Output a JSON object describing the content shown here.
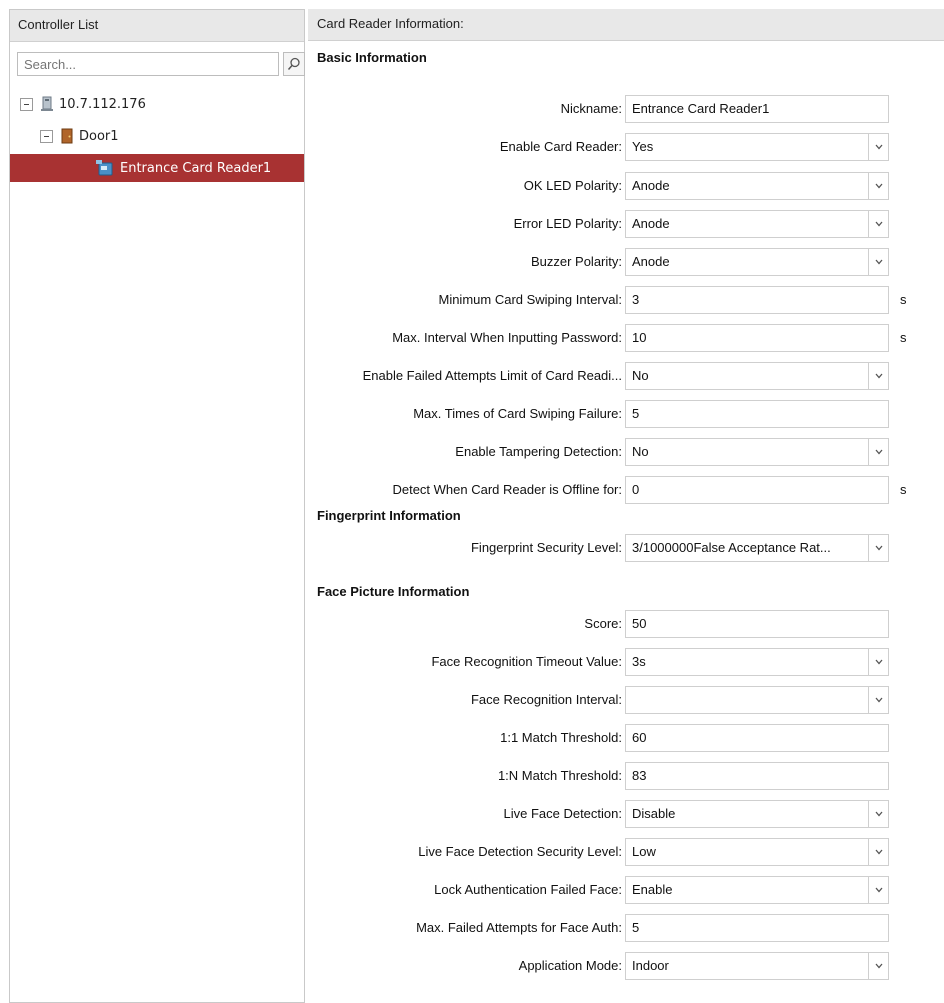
{
  "left": {
    "header": "Controller List",
    "search": {
      "placeholder": "Search..."
    },
    "tree": {
      "controller": "10.7.112.176",
      "door": "Door1",
      "reader": "Entrance Card Reader1"
    }
  },
  "right": {
    "header": "Card Reader Information:",
    "sections": {
      "basic": "Basic Information",
      "fingerprint": "Fingerprint Information",
      "face": "Face Picture Information"
    },
    "fields": [
      {
        "label": "Nickname:",
        "value": "Entrance Card Reader1",
        "type": "text"
      },
      {
        "label": "Enable Card Reader:",
        "value": "Yes",
        "type": "select"
      },
      {
        "label": "OK LED Polarity:",
        "value": "Anode",
        "type": "select"
      },
      {
        "label": "Error LED Polarity:",
        "value": "Anode",
        "type": "select"
      },
      {
        "label": "Buzzer Polarity:",
        "value": "Anode",
        "type": "select"
      },
      {
        "label": "Minimum Card Swiping Interval:",
        "value": "3",
        "type": "text",
        "unit": "s"
      },
      {
        "label": "Max. Interval When Inputting Password:",
        "value": "10",
        "type": "text",
        "unit": "s"
      },
      {
        "label": "Enable Failed Attempts Limit of Card Readi...",
        "value": "No",
        "type": "select"
      },
      {
        "label": "Max. Times of Card Swiping Failure:",
        "value": "5",
        "type": "text"
      },
      {
        "label": "Enable Tampering Detection:",
        "value": "No",
        "type": "select"
      },
      {
        "label": "Detect When Card Reader is Offline for:",
        "value": "0",
        "type": "text",
        "unit": "s"
      },
      {
        "label": "Fingerprint Security Level:",
        "value": "3/1000000False Acceptance Rat...",
        "type": "select"
      },
      {
        "label": "Score:",
        "value": "50",
        "type": "text"
      },
      {
        "label": "Face Recognition Timeout Value:",
        "value": "3s",
        "type": "select"
      },
      {
        "label": "Face Recognition Interval:",
        "value": "",
        "type": "select"
      },
      {
        "label": "1:1 Match Threshold:",
        "value": "60",
        "type": "text"
      },
      {
        "label": "1:N Match Threshold:",
        "value": "83",
        "type": "text"
      },
      {
        "label": "Live Face Detection:",
        "value": "Disable",
        "type": "select"
      },
      {
        "label": "Live Face Detection Security Level:",
        "value": "Low",
        "type": "select"
      },
      {
        "label": "Lock Authentication Failed Face:",
        "value": "Enable",
        "type": "select"
      },
      {
        "label": "Max. Failed Attempts for Face Auth:",
        "value": "5",
        "type": "text"
      },
      {
        "label": "Application Mode:",
        "value": "Indoor",
        "type": "select"
      }
    ]
  },
  "colors": {
    "selected_row": "#a83232",
    "header_bg": "#e8e8e8"
  },
  "icons": {
    "search": "search-icon",
    "controller": "controller-icon",
    "door": "door-icon",
    "reader": "card-reader-icon",
    "dropdown": "chevron-down-icon"
  }
}
